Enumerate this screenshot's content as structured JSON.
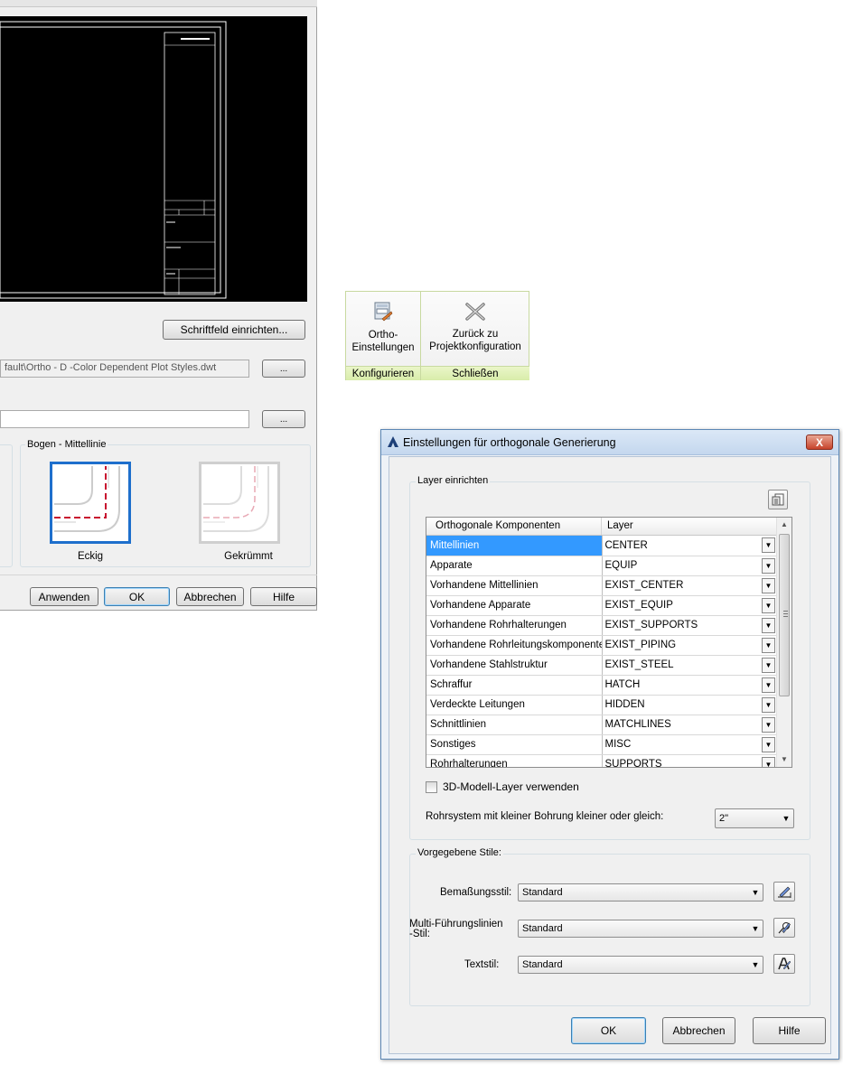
{
  "left_dialog": {
    "title_block_button": "Schriftfeld einrichten...",
    "template_path": "fault\\Ortho - D -Color Dependent Plot Styles.dwt",
    "browse_label": "...",
    "second_path": "",
    "bend_group_title": "Bogen - Mittellinie",
    "bend_options": [
      {
        "label": "Eckig",
        "selected": true
      },
      {
        "label": "Gekrümmt",
        "selected": false
      }
    ],
    "buttons": {
      "apply": "Anwenden",
      "ok": "OK",
      "cancel": "Abbrechen",
      "help": "Hilfe"
    }
  },
  "ribbon": {
    "buttons": [
      {
        "line1": "Ortho-",
        "line2": "Einstellungen",
        "icon": "settings-dialog-icon"
      },
      {
        "line1": "Zurück zu",
        "line2": "Projektkonfiguration",
        "icon": "close-x-icon"
      }
    ],
    "panels": [
      "Konfigurieren",
      "Schließen"
    ]
  },
  "dialog": {
    "title": "Einstellungen für orthogonale Generierung",
    "close_label": "X",
    "layer_group": "Layer einrichten",
    "columns": [
      "Orthogonale Komponenten",
      "Layer"
    ],
    "rows": [
      {
        "component": "Mittellinien",
        "layer": "CENTER"
      },
      {
        "component": "Apparate",
        "layer": "EQUIP"
      },
      {
        "component": "Vorhandene Mittellinien",
        "layer": "EXIST_CENTER"
      },
      {
        "component": "Vorhandene Apparate",
        "layer": "EXIST_EQUIP"
      },
      {
        "component": "Vorhandene Rohrhalterungen",
        "layer": "EXIST_SUPPORTS"
      },
      {
        "component": "Vorhandene Rohrleitungskomponenten",
        "layer": "EXIST_PIPING"
      },
      {
        "component": "Vorhandene Stahlstruktur",
        "layer": "EXIST_STEEL"
      },
      {
        "component": "Schraffur",
        "layer": "HATCH"
      },
      {
        "component": "Verdeckte Leitungen",
        "layer": "HIDDEN"
      },
      {
        "component": "Schnittlinien",
        "layer": "MATCHLINES"
      },
      {
        "component": "Sonstiges",
        "layer": "MISC"
      },
      {
        "component": "Rohrhalterungen",
        "layer": "SUPPORTS"
      }
    ],
    "use_3d_layers": "3D-Modell-Layer verwenden",
    "small_bore_label": "Rohrsystem mit kleiner Bohrung kleiner oder gleich:",
    "small_bore_value": "2\"",
    "styles_group": "Vorgegebene Stile:",
    "dim_style_label": "Bemaßungsstil:",
    "mleader_label_1": "Multi-Führungslinien",
    "mleader_label_2": "-Stil:",
    "text_style_label": "Textstil:",
    "style_value": "Standard",
    "buttons": {
      "ok": "OK",
      "cancel": "Abbrechen",
      "help": "Hilfe"
    }
  }
}
